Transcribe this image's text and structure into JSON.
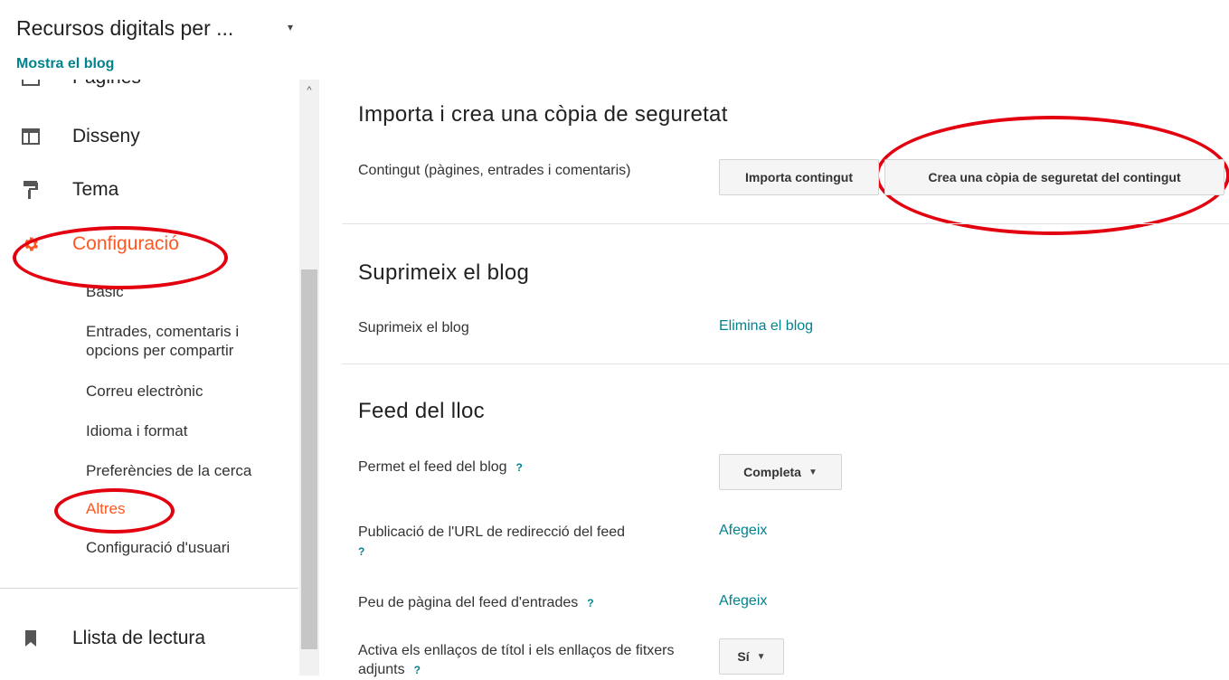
{
  "header": {
    "blog_title": "Recursos digitals per ...",
    "blog_caret": "▾",
    "view_blog": "Mostra el blog"
  },
  "sidebar": {
    "partial_item": "Pàgines",
    "items": [
      {
        "label": "Disseny",
        "icon": "layout-icon"
      },
      {
        "label": "Tema",
        "icon": "paint-roller-icon"
      },
      {
        "label": "Configuració",
        "icon": "gear-icon"
      }
    ],
    "sub_items": [
      "Bàsic",
      "Entrades, comentaris i opcions per compartir",
      "Correu electrònic",
      "Idioma i format",
      "Preferències de la cerca",
      "Altres",
      "Configuració d'usuari"
    ],
    "reading_list": {
      "label": "Llista de lectura",
      "icon": "bookmark-icon"
    }
  },
  "scrollbar": {
    "up_arrow": "^"
  },
  "main": {
    "import_section": {
      "title": "Importa i crea una còpia de seguretat",
      "content_label": "Contingut (pàgines, entrades i comentaris)",
      "import_button": "Importa contingut",
      "backup_button": "Crea una còpia de seguretat del contingut"
    },
    "delete_section": {
      "title": "Suprimeix el blog",
      "label": "Suprimeix el blog",
      "link": "Elimina el blog"
    },
    "feed_section": {
      "title": "Feed del lloc",
      "allow_feed_label": "Permet el feed del blog",
      "allow_feed_value": "Completa",
      "redirect_label": "Publicació de l'URL de redirecció del feed",
      "redirect_link": "Afegeix",
      "footer_label": "Peu de pàgina del feed d'entrades",
      "footer_link": "Afegeix",
      "title_links_label": "Activa els enllaços de títol i els enllaços de fitxers adjunts",
      "title_links_value": "Sí",
      "help": "?"
    }
  },
  "colors": {
    "accent_teal": "#00838f",
    "active_orange": "#ff5722",
    "annotation_red": "#e3000f"
  }
}
